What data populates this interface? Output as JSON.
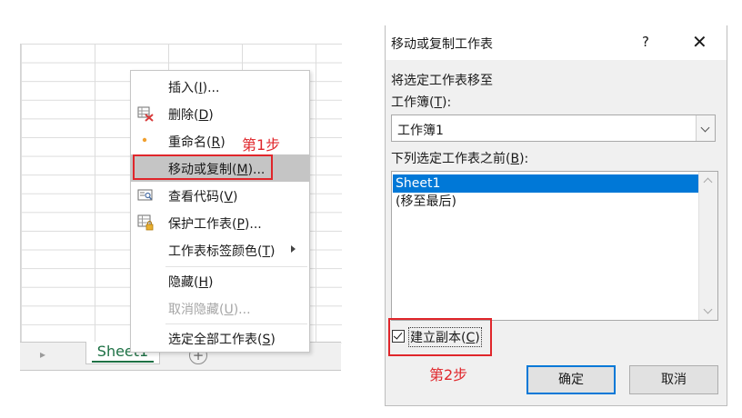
{
  "context_menu": {
    "items": [
      {
        "text": "插入(",
        "key": "I",
        "tail": ")..."
      },
      {
        "text": "删除(",
        "key": "D",
        "tail": ")"
      },
      {
        "text": "重命名(",
        "key": "R",
        "tail": ")"
      },
      {
        "text": "移动或复制(",
        "key": "M",
        "tail": ")..."
      },
      {
        "text": "查看代码(",
        "key": "V",
        "tail": ")"
      },
      {
        "text": "保护工作表(",
        "key": "P",
        "tail": ")..."
      },
      {
        "text": "工作表标签颜色(",
        "key": "T",
        "tail": ")"
      },
      {
        "text": "隐藏(",
        "key": "H",
        "tail": ")"
      },
      {
        "text": "取消隐藏(",
        "key": "U",
        "tail": ")..."
      },
      {
        "text": "选定全部工作表(",
        "key": "S",
        "tail": ")"
      }
    ]
  },
  "annotations": {
    "step1": "第1步",
    "step2": "第2步"
  },
  "sheet_tab": {
    "name": "Sheet1"
  },
  "dialog": {
    "title": "移动或复制工作表",
    "help": "?",
    "close": "✕",
    "move_to_label": "将选定工作表移至",
    "workbook_label": {
      "text": "工作簿(",
      "key": "T",
      "tail": "):"
    },
    "workbook_value": "工作簿1",
    "before_label": {
      "text": "下列选定工作表之前(",
      "key": "B",
      "tail": "):"
    },
    "list_items": [
      "Sheet1",
      "(移至最后)"
    ],
    "create_copy": {
      "text": "建立副本(",
      "key": "C",
      "tail": ")",
      "checked": true
    },
    "ok": "确定",
    "cancel": "取消"
  },
  "colors": {
    "annotation_red": "#e0262b",
    "selection_blue": "#0078d7",
    "excel_green": "#1e7145"
  }
}
